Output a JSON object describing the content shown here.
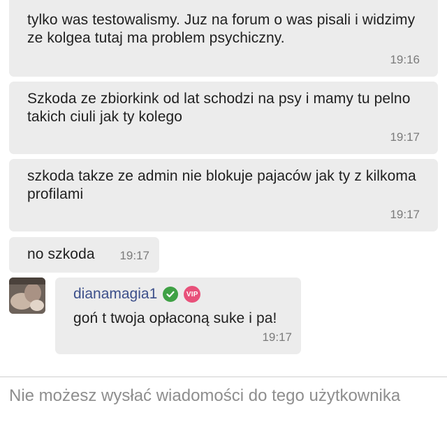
{
  "messages": [
    {
      "text": "tylko was testowalismy. Juz na forum o was pisali i widzimy ze kolgea tutaj ma problem psychiczny.",
      "time": "19:16"
    },
    {
      "text": "Szkoda ze zbiorkink od lat schodzi na psy i mamy tu pelno takich ciuli jak ty kolego",
      "time": "19:17"
    },
    {
      "text": "szkoda takze ze admin nie blokuje pajaców jak ty z kilkoma profilami",
      "time": "19:17"
    },
    {
      "text": "no szkoda",
      "time": "19:17"
    }
  ],
  "incoming": {
    "sender": "dianamagia1",
    "badge_vip": "VIP",
    "text": "goń t twoja opłaconą suke i pa!",
    "time": "19:17"
  },
  "composer": {
    "notice": "Nie możesz wysłać wiadomości do tego użytkownika"
  },
  "colors": {
    "bubble_bg": "#ececec",
    "sender_name": "#3c4f8a",
    "verified": "#3fa145",
    "vip": "#e8517a",
    "timestamp": "#7b7b7b"
  }
}
